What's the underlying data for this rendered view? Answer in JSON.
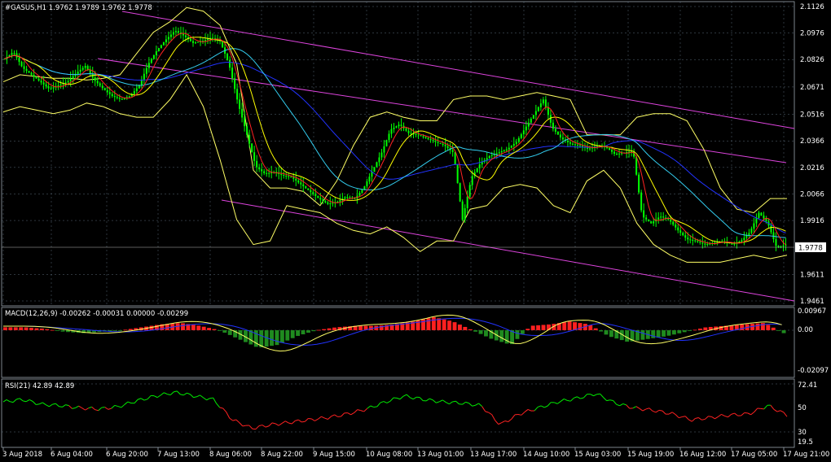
{
  "colors": {
    "background": "#000000",
    "grid": "#5a6b7a",
    "candle": "#00ff00",
    "bollinger": "#ffff66",
    "ma_red": "#ff2222",
    "ma_yellow": "#ffff00",
    "ma_blue": "#2233ff",
    "ma_cyan": "#33ccee",
    "channel": "#dd44dd",
    "macd_hist_pos": "#ff2020",
    "macd_hist_neg": "#1f8a1f",
    "macd_line": "#ffff66",
    "macd_signal": "#2233ff",
    "rsi_up": "#00ee00",
    "rsi_down": "#ff2222",
    "price_tag_bg": "#ffffff",
    "price_tag_fg": "#000000"
  },
  "main_panel": {
    "header": "#GASUS,H1 1.9762 1.9789 1.9762 1.9778",
    "price_ticks": [
      "2.1126",
      "2.0976",
      "2.0826",
      "2.0671",
      "2.0516",
      "2.0366",
      "2.0216",
      "2.0066",
      "1.9916",
      "1.9611",
      "1.9461"
    ],
    "current_price": "1.9778"
  },
  "macd_panel": {
    "header": "MACD(12,26,9) -0.00262 -0.00031 0.00000 -0.00299",
    "ticks": [
      "0.00967",
      "0.00",
      "-0.02097"
    ]
  },
  "rsi_panel": {
    "header": "RSI(21) 42.89 42.89",
    "ticks": [
      "72.41",
      "50",
      "30",
      "19.5"
    ],
    "levels": [
      70,
      30
    ]
  },
  "time_axis": [
    "3 Aug 2018",
    "6 Aug 04:00",
    "6 Aug 20:00",
    "7 Aug 13:00",
    "8 Aug 06:00",
    "8 Aug 22:00",
    "9 Aug 15:00",
    "10 Aug 08:00",
    "13 Aug 01:00",
    "13 Aug 17:00",
    "14 Aug 10:00",
    "15 Aug 03:00",
    "15 Aug 19:00",
    "16 Aug 12:00",
    "17 Aug 05:00",
    "17 Aug 21:00"
  ],
  "chart_data": {
    "type": "candlestick",
    "symbol": "#GASUS",
    "timeframe": "H1",
    "close_path": [
      2.083,
      2.087,
      2.078,
      2.074,
      2.07,
      2.066,
      2.068,
      2.07,
      2.075,
      2.079,
      2.071,
      2.066,
      2.062,
      2.06,
      2.062,
      2.068,
      2.08,
      2.088,
      2.094,
      2.099,
      2.096,
      2.092,
      2.093,
      2.095,
      2.093,
      2.08,
      2.058,
      2.04,
      2.022,
      2.018,
      2.019,
      2.017,
      2.016,
      2.012,
      2.008,
      2.004,
      2.001,
      2.002,
      2.005,
      2.004,
      2.01,
      2.02,
      2.03,
      2.043,
      2.046,
      2.041,
      2.04,
      2.038,
      2.036,
      2.034,
      2.03,
      1.992,
      2.016,
      2.024,
      2.028,
      2.03,
      2.032,
      2.036,
      2.044,
      2.052,
      2.06,
      2.044,
      2.038,
      2.035,
      2.034,
      2.032,
      2.034,
      2.033,
      2.029,
      2.03,
      2.031,
      1.994,
      1.99,
      1.994,
      1.992,
      1.986,
      1.981,
      1.98,
      1.978,
      1.979,
      1.98,
      1.978,
      1.98,
      1.985,
      1.996,
      1.99,
      1.976,
      1.978
    ],
    "bollinger_upper": [
      2.07,
      2.074,
      2.073,
      2.072,
      2.072,
      2.071,
      2.072,
      2.074,
      2.086,
      2.098,
      2.104,
      2.112,
      2.11,
      2.102,
      2.08,
      2.02,
      2.01,
      2.01,
      2.008,
      2.0,
      2.014,
      2.034,
      2.05,
      2.053,
      2.05,
      2.048,
      2.048,
      2.06,
      2.062,
      2.062,
      2.06,
      2.062,
      2.064,
      2.062,
      2.06,
      2.04,
      2.04,
      2.04,
      2.05,
      2.052,
      2.052,
      2.048,
      2.032,
      2.01,
      1.998,
      1.996,
      2.004,
      2.004
    ],
    "bollinger_lower": [
      2.053,
      2.056,
      2.054,
      2.052,
      2.054,
      2.058,
      2.056,
      2.052,
      2.05,
      2.05,
      2.06,
      2.074,
      2.056,
      2.026,
      1.992,
      1.978,
      1.98,
      2.0,
      1.998,
      1.996,
      1.99,
      1.986,
      1.984,
      1.988,
      1.982,
      1.974,
      1.98,
      1.98,
      1.998,
      2.0,
      2.01,
      2.012,
      2.01,
      2.0,
      1.996,
      2.014,
      2.02,
      2.01,
      1.99,
      1.978,
      1.972,
      1.968,
      1.968,
      1.968,
      1.97,
      1.972,
      1.97,
      1.972
    ],
    "macd_histogram": [
      0.002,
      0.002,
      0.001,
      -0.001,
      -0.002,
      -0.001,
      0.0,
      0.002,
      0.004,
      0.005,
      0.003,
      0.0,
      -0.006,
      -0.012,
      -0.01,
      -0.004,
      0.0,
      0.002,
      0.003,
      0.003,
      0.004,
      0.006,
      0.009,
      0.006,
      0.0,
      -0.006,
      -0.01,
      0.003,
      0.004,
      0.006,
      0.004,
      -0.004,
      -0.008,
      -0.006,
      -0.004,
      -0.001,
      0.002,
      0.003,
      0.004,
      0.005,
      -0.002
    ],
    "rsi": [
      55,
      57,
      53,
      52,
      50,
      49,
      51,
      56,
      60,
      63,
      60,
      57,
      40,
      33,
      36,
      38,
      40,
      42,
      45,
      49,
      55,
      60,
      57,
      55,
      54,
      52,
      36,
      45,
      50,
      55,
      58,
      62,
      54,
      50,
      48,
      45,
      40,
      42,
      44,
      45,
      52,
      44
    ]
  }
}
